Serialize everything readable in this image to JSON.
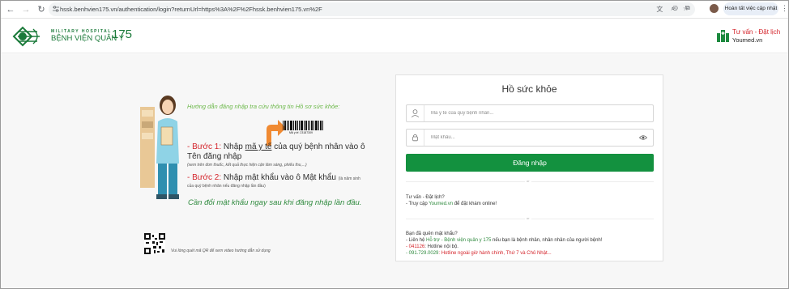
{
  "browser": {
    "url": "hssk.benhvien175.vn/authentication/login?returnUrl=https%3A%2F%2Fhssk.benhvien175.vn%2F",
    "update_label": "Hoàn tất việc cập nhật"
  },
  "header": {
    "logo_small": "MILITARY HOSPITAL",
    "logo_big": "BỆNH VIỆN QUÂN Y",
    "logo_num": "175",
    "youmed_top": "Tư vấn - Đặt lịch",
    "youmed_bottom": "Youmed.vn"
  },
  "guide": {
    "title": "Hướng dẫn đăng nhập tra cứu thông tin Hồ sơ sức khỏe:",
    "barcode_text": "Mã y tế: 23187309",
    "step1_label": "- Bước 1:",
    "step1_pre": " Nhập ",
    "step1_link": "mã y tế",
    "step1_post": " của quý bệnh nhân vào ô Tên đăng nhập",
    "step1_note": "(xem trên đơn thuốc, kết quả thực hiện cận lâm sàng, phiếu thu,...)",
    "step2_label": "- Bước 2:",
    "step2_text": " Nhập mật khẩu vào ô Mật khẩu",
    "step2_note_a": "(là năm sinh",
    "step2_note_b": "của quý bệnh nhân nếu đăng nhập lần đầu)",
    "change_pw": "Cần đổi mật khẩu ngay sau khi đăng nhập lần đầu.",
    "qr_text": "Vui lòng quét mã QR để xem video hướng dẫn sử dụng"
  },
  "login": {
    "title": "Hồ sức khỏe",
    "username_placeholder": "Mã y tế của quý bệnh nhân...",
    "password_placeholder": "Mật khẩu...",
    "button": "Đăng nhập",
    "or": "or",
    "consult_title": "Tư vấn - Đặt lịch?",
    "consult_line_a": "- Truy cập ",
    "consult_link": "Youmed.vn",
    "consult_line_b": " để đặt khám online!",
    "forgot_title": "Bạn đã quên mật khẩu?",
    "forgot_line1_a": "- Liên hệ ",
    "forgot_line1_link": "Hỗ trợ - Bệnh viện quân y 175",
    "forgot_line1_b": " nếu bạn là bệnh nhân, nhân nhân của người bệnh!",
    "forgot_line2_num": "- 041126",
    "forgot_line2_text": ": Hotline nội bộ.",
    "forgot_line3_num": "- 091.729.0029",
    "forgot_line3_text": ": Hotline ngoài giờ hành chính, Thứ 7 và Chủ Nhật..."
  }
}
